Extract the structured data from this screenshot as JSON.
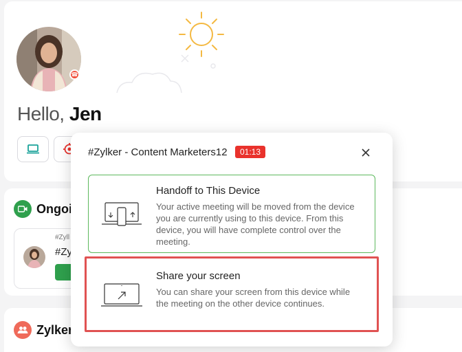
{
  "greeting": {
    "hello": "Hello,",
    "name": "Jen"
  },
  "sections": {
    "ongoing": {
      "title": "Ongoi",
      "icon": "video-camera-icon",
      "color": "#2fa04d"
    },
    "team": {
      "title": "Zylker",
      "icon": "people-icon",
      "color": "#ef6a5a"
    }
  },
  "meeting_card": {
    "small_text": "#Zyll",
    "name": "#Zy"
  },
  "dialog": {
    "title": "#Zylker - Content Marketers12",
    "timer": "01:13",
    "options": [
      {
        "title": "Handoff to This Device",
        "description": "Your active meeting will be moved from the device you are currently using to this device. From this device, you will have complete control over the meeting.",
        "icon": "device-handoff-icon"
      },
      {
        "title": "Share your screen",
        "description": "You can share your screen from this device while the meeting on the other device continues.",
        "icon": "share-screen-icon"
      }
    ]
  },
  "colors": {
    "accent_green": "#2fa04d",
    "timer_red": "#e9322c",
    "highlight_red": "#e05252",
    "sun_orange": "#f4b942"
  }
}
